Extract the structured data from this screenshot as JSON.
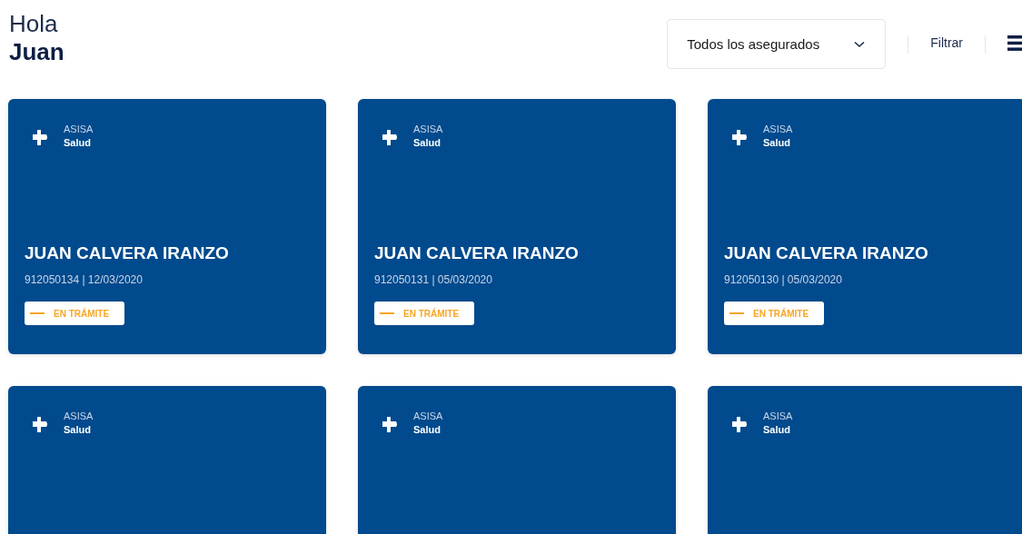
{
  "greeting": {
    "line_1": "Hola",
    "name": "Juan"
  },
  "toolbar": {
    "dropdown": {
      "value": "Todos los asegurados"
    },
    "filter_label": "Filtrar"
  },
  "cards": [
    {
      "brand": "ASISA",
      "product": "Salud",
      "holder": "JUAN CALVERA IRANZO",
      "reference": "912050134 | 12/03/2020",
      "status": "EN TRÁMITE"
    },
    {
      "brand": "ASISA",
      "product": "Salud",
      "holder": "JUAN CALVERA IRANZO",
      "reference": "912050131 | 05/03/2020",
      "status": "EN TRÁMITE"
    },
    {
      "brand": "ASISA",
      "product": "Salud",
      "holder": "JUAN CALVERA IRANZO",
      "reference": "912050130 | 05/03/2020",
      "status": "EN TRÁMITE"
    },
    {
      "brand": "ASISA",
      "product": "Salud"
    },
    {
      "brand": "ASISA",
      "product": "Salud"
    },
    {
      "brand": "ASISA",
      "product": "Salud"
    }
  ]
}
